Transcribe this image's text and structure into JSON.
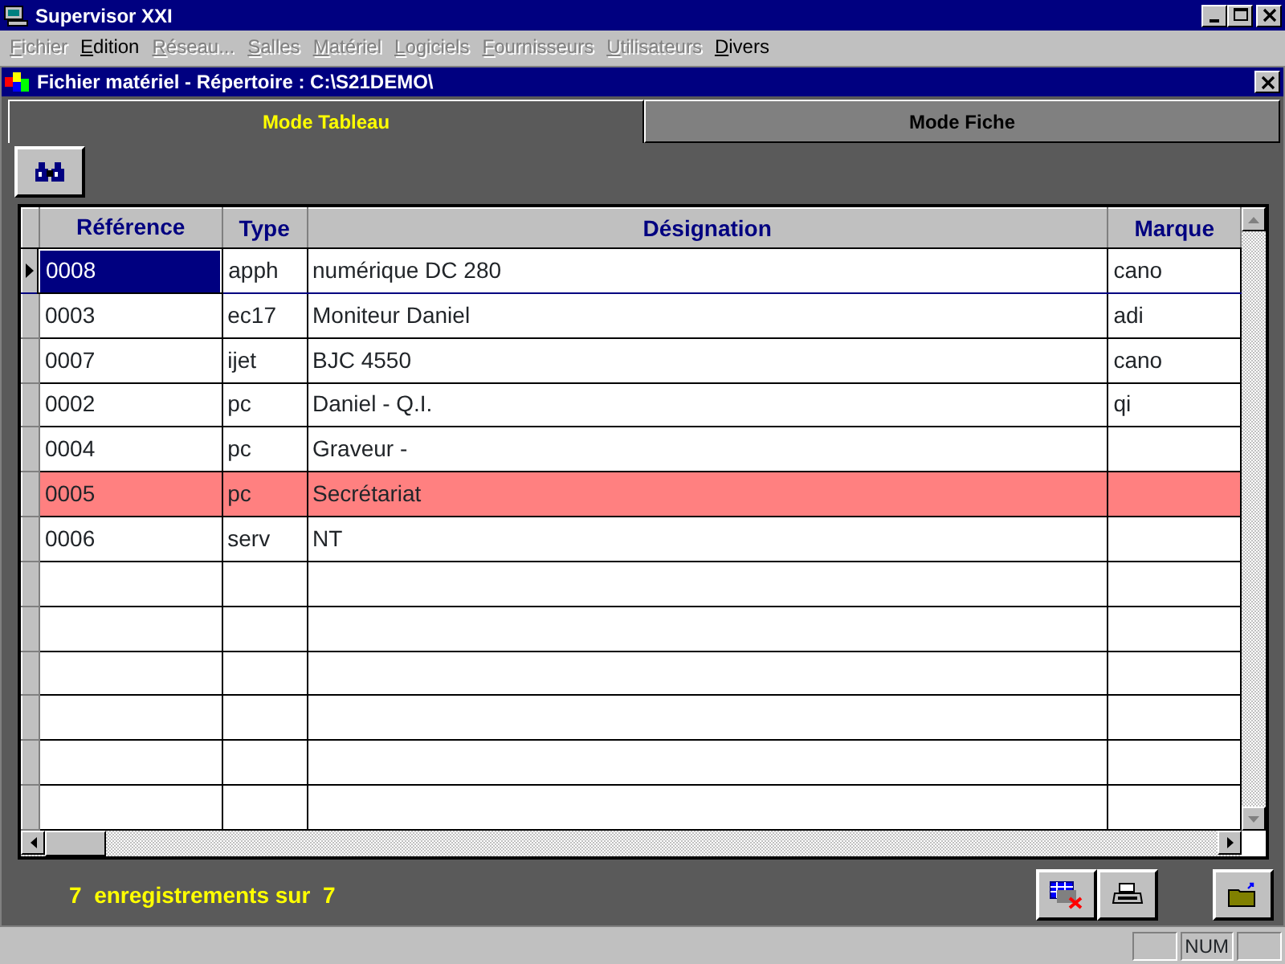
{
  "window": {
    "title": "Supervisor XXI"
  },
  "menu": [
    {
      "label": "Fichier",
      "disabled": true
    },
    {
      "label": "Edition",
      "disabled": false
    },
    {
      "label": "Réseau...",
      "disabled": true
    },
    {
      "label": "Salles",
      "disabled": true
    },
    {
      "label": "Matériel",
      "disabled": true
    },
    {
      "label": "Logiciels",
      "disabled": true
    },
    {
      "label": "Fournisseurs",
      "disabled": true
    },
    {
      "label": "Utilisateurs",
      "disabled": true
    },
    {
      "label": "Divers",
      "disabled": false
    }
  ],
  "child_window": {
    "title": "Fichier matériel - Répertoire : C:\\S21DEMO\\"
  },
  "tabs": [
    {
      "label": "Mode Tableau",
      "selected": true
    },
    {
      "label": "Mode Fiche",
      "selected": false
    }
  ],
  "table": {
    "columns": [
      "Référence",
      "Type",
      "Désignation",
      "Marque"
    ],
    "rows": [
      {
        "cells": [
          "0008",
          "apph",
          "numérique DC 280",
          "cano"
        ],
        "selected": true,
        "highlighted": false
      },
      {
        "cells": [
          "0003",
          "ec17",
          "Moniteur Daniel",
          "adi"
        ],
        "selected": false,
        "highlighted": false
      },
      {
        "cells": [
          "0007",
          "ijet",
          "BJC 4550",
          "cano"
        ],
        "selected": false,
        "highlighted": false
      },
      {
        "cells": [
          "0002",
          "pc",
          "Daniel - Q.I.",
          "qi"
        ],
        "selected": false,
        "highlighted": false
      },
      {
        "cells": [
          "0004",
          "pc",
          "Graveur -",
          ""
        ],
        "selected": false,
        "highlighted": false
      },
      {
        "cells": [
          "0005",
          "pc",
          "Secrétariat",
          ""
        ],
        "selected": false,
        "highlighted": true
      },
      {
        "cells": [
          "0006",
          "serv",
          "NT",
          ""
        ],
        "selected": false,
        "highlighted": false
      }
    ]
  },
  "record_count": "7  enregistrements sur  7",
  "status_bar": {
    "panes": [
      "NUM"
    ]
  }
}
